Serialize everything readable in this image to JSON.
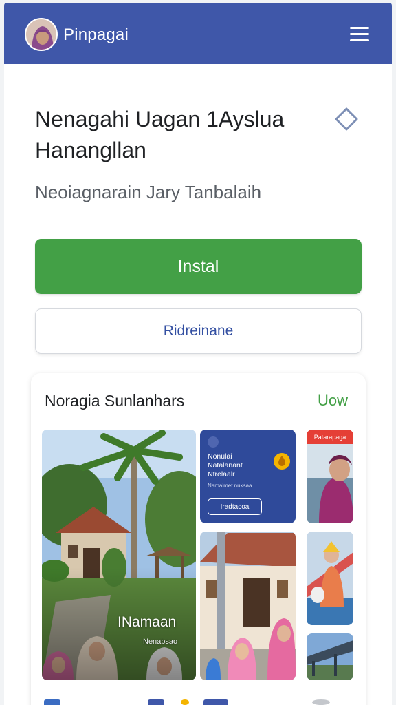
{
  "app": {
    "title": "Pinpagai",
    "accent": "#3f57a9",
    "icons": [
      "avatar",
      "menu-icon"
    ]
  },
  "header": {
    "headline": "Nenagahi Uagan 1Ayslua\nHanangllan",
    "subtitle": "Neoiagnarain Jary Tanbalaih",
    "share_icon": "diamond-icon"
  },
  "buttons": {
    "install_label": "Instal",
    "install_color": "#43a046",
    "secondary_label": "Ridreinane"
  },
  "gallery": {
    "title": "Noragia Sunlanhars",
    "link": "Uow",
    "tiles": [
      {
        "title": "INamaan",
        "subtitle": "Nenabsao"
      },
      {
        "lines": [
          "Nonulai",
          "Natalanant",
          "Ntrelaalr"
        ],
        "caption": "Namalmet nuksaa",
        "button": "Iradtacoa",
        "badge_icon": "drop-icon"
      },
      {
        "badge": "Patarapaga"
      }
    ]
  }
}
